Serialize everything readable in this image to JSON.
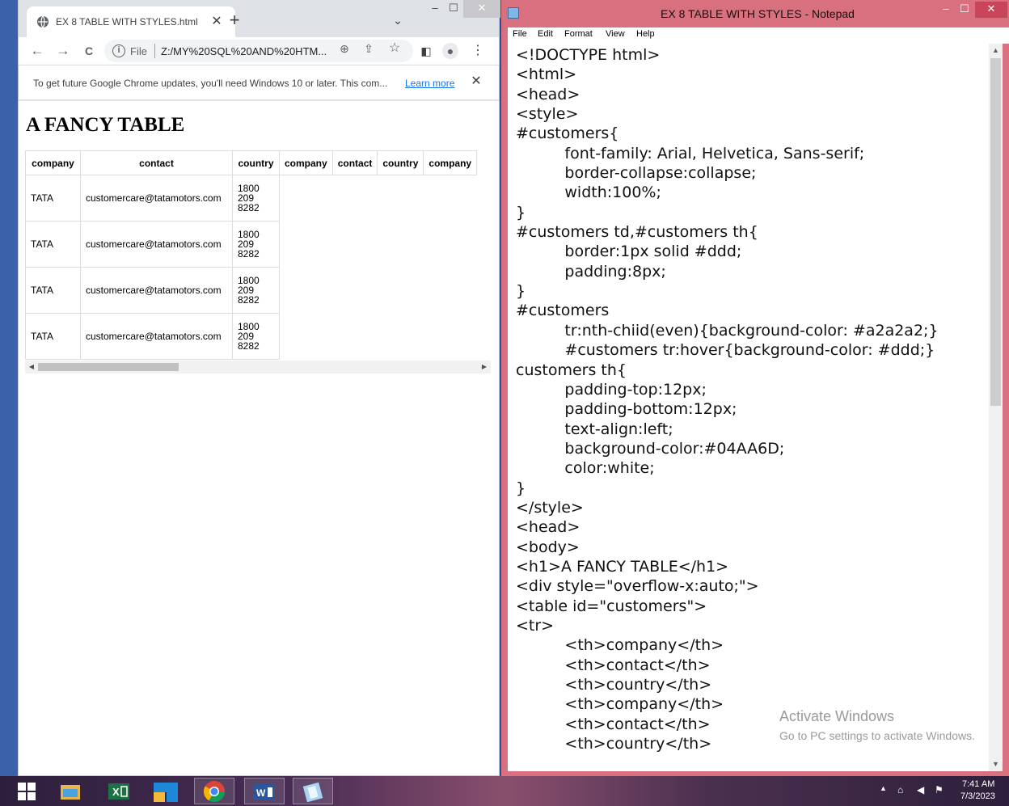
{
  "chrome": {
    "tab_title": "EX 8 TABLE WITH STYLES.html",
    "tab_close": "✕",
    "new_tab": "+",
    "tab_search": "⌄",
    "minimize": "–",
    "maximize": "☐",
    "close": "✕",
    "back": "←",
    "forward": "→",
    "reload": "C",
    "scheme": "File",
    "url": "Z:/MY%20SQL%20AND%20HTM...",
    "zoom_icon": "⊕",
    "share_icon": "⇪",
    "bookmark_icon": "☆",
    "sidepanel_icon": "◧",
    "profile_icon": "●",
    "menu_icon": "⋮",
    "info_message": "To get future Google Chrome updates, you'll need Windows 10 or later. This com...",
    "info_link": "Learn more",
    "info_close": "✕"
  },
  "page": {
    "heading": "A FANCY TABLE",
    "headers": [
      "company",
      "contact",
      "country",
      "company",
      "contact",
      "country",
      "company"
    ],
    "rows": [
      {
        "company": "TATA",
        "contact": "customercare@tatamotors.com",
        "country": [
          "1800",
          "209",
          "8282"
        ]
      },
      {
        "company": "TATA",
        "contact": "customercare@tatamotors.com",
        "country": [
          "1800",
          "209",
          "8282"
        ]
      },
      {
        "company": "TATA",
        "contact": "customercare@tatamotors.com",
        "country": [
          "1800",
          "209",
          "8282"
        ]
      },
      {
        "company": "TATA",
        "contact": "customercare@tatamotors.com",
        "country": [
          "1800",
          "209",
          "8282"
        ]
      }
    ]
  },
  "notepad": {
    "title": "EX 8 TABLE WITH STYLES - Notepad",
    "menu": [
      "File",
      "Edit",
      "Format",
      "View",
      "Help"
    ],
    "code_lines": [
      "<!DOCTYPE html>",
      "<html>",
      "<head>",
      "<style>",
      "#customers{",
      "          font-family: Arial, Helvetica, Sans-serif;",
      "          border-collapse:collapse;",
      "          width:100%;",
      "}",
      "#customers td,#customers th{",
      "          border:1px solid #ddd;",
      "          padding:8px;",
      "}",
      "#customers",
      "          tr:nth-chiid(even){background-color: #a2a2a2;}",
      "          #customers tr:hover{background-color: #ddd;}",
      "customers th{",
      "          padding-top:12px;",
      "          padding-bottom:12px;",
      "          text-align:left;",
      "          background-color:#04AA6D;",
      "          color:white;",
      "}",
      "</style>",
      "<head>",
      "<body>",
      "<h1>A FANCY TABLE</h1>",
      "<div style=\"overflow-x:auto;\">",
      "<table id=\"customers\">",
      "<tr>",
      "          <th>company</th>",
      "          <th>contact</th>",
      "          <th>country</th>",
      "          <th>company</th>",
      "          <th>contact</th>",
      "          <th>country</th>"
    ],
    "watermark_title": "Activate Windows",
    "watermark_sub": "Go to PC settings to activate Windows."
  },
  "taskbar": {
    "apps": [
      {
        "name": "start-button",
        "glyph": "⊞"
      },
      {
        "name": "file-explorer-icon",
        "glyph": "▤"
      },
      {
        "name": "excel-icon",
        "glyph": "X"
      },
      {
        "name": "blue-app-icon",
        "glyph": "▆"
      },
      {
        "name": "chrome-icon",
        "glyph": "◉"
      },
      {
        "name": "word-icon",
        "glyph": "W"
      },
      {
        "name": "notepad-icon",
        "glyph": "◩"
      }
    ],
    "time": "7:41 AM",
    "date": "7/3/2023"
  },
  "colors": {
    "notepad_frame": "#d9707f",
    "chrome_tabbar": "#dee1e6",
    "link": "#1a73e8"
  }
}
